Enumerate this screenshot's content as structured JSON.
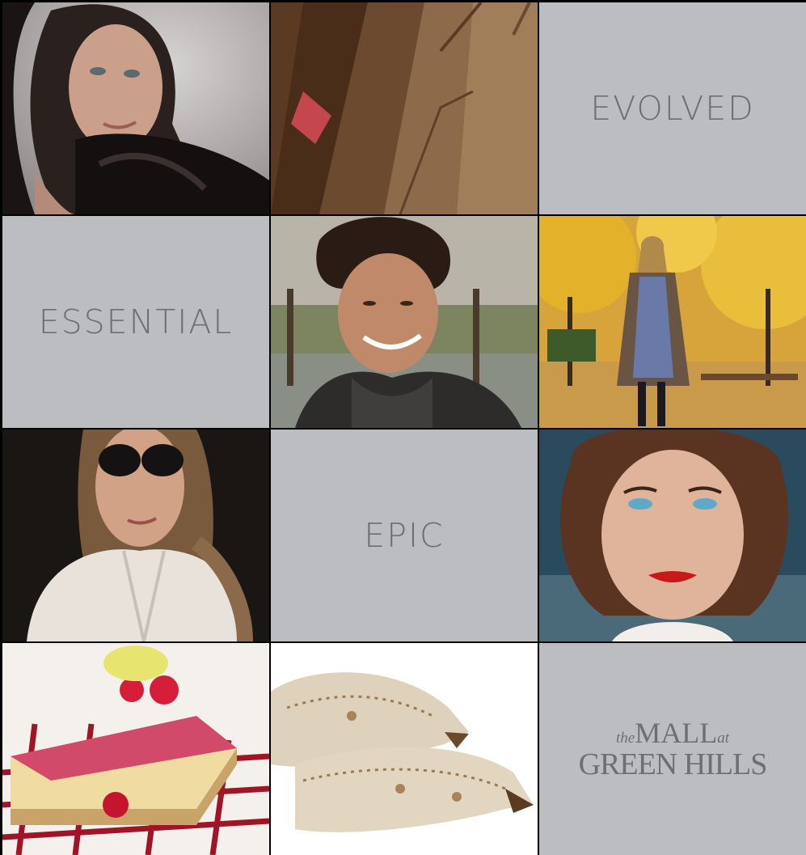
{
  "tiles": {
    "evolved": "EVOLVED",
    "essential": "ESSENTIAL",
    "epic": "EPIC"
  },
  "logo": {
    "the": "the",
    "mall": "MALL",
    "at": "at",
    "green_hills": "GREEN HILLS"
  },
  "colors": {
    "background": "#000000",
    "tile_gray": "#bbbdc0",
    "text_gray": "#6e6f73"
  }
}
